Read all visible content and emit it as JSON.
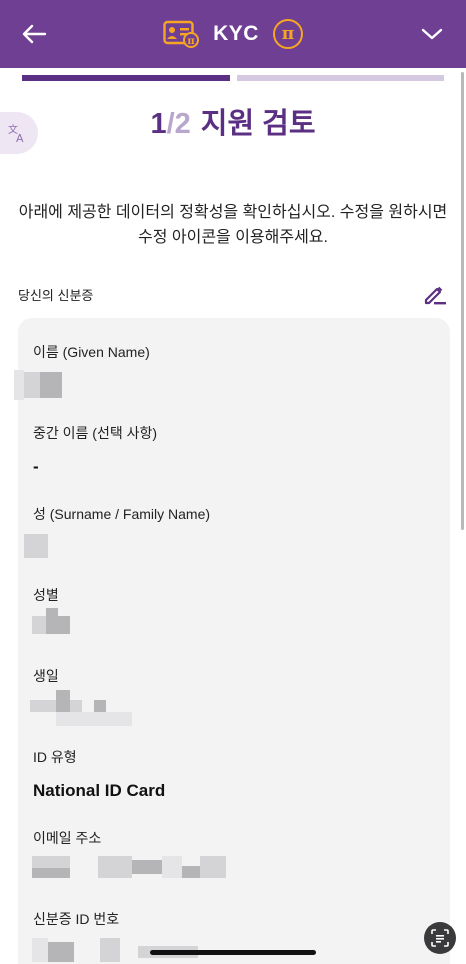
{
  "header": {
    "title": "KYC",
    "back_icon": "arrow-left-icon",
    "id_card_icon": "id-card-icon",
    "pi_symbol": "π",
    "chevron_icon": "chevron-down-icon",
    "bg_color": "#6f3f94",
    "accent_color": "#f6a623"
  },
  "progress": {
    "current_step": 1,
    "total_steps": 2
  },
  "step": {
    "current": "1",
    "separator_total": "/2",
    "title": "지원 검토"
  },
  "instruction": "아래에 제공한 데이터의 정확성을 확인하십시오. 수정을 원하시면 수정 아이콘을 이용해주세요.",
  "section": {
    "label": "당신의 신분증",
    "edit_icon": "edit-pencil-icon"
  },
  "fields": [
    {
      "label": "이름 (Given Name)",
      "value": ""
    },
    {
      "label": "중간 이름 (선택 사항)",
      "value": "-"
    },
    {
      "label": "성 (Surname / Family Name)",
      "value": ""
    },
    {
      "label": "성별",
      "value": ""
    },
    {
      "label": "생일",
      "value": ""
    },
    {
      "label": "ID 유형",
      "value": "National ID Card"
    },
    {
      "label": "이메일 주소",
      "value": ""
    },
    {
      "label": "신분증 ID 번호",
      "value": ""
    }
  ]
}
